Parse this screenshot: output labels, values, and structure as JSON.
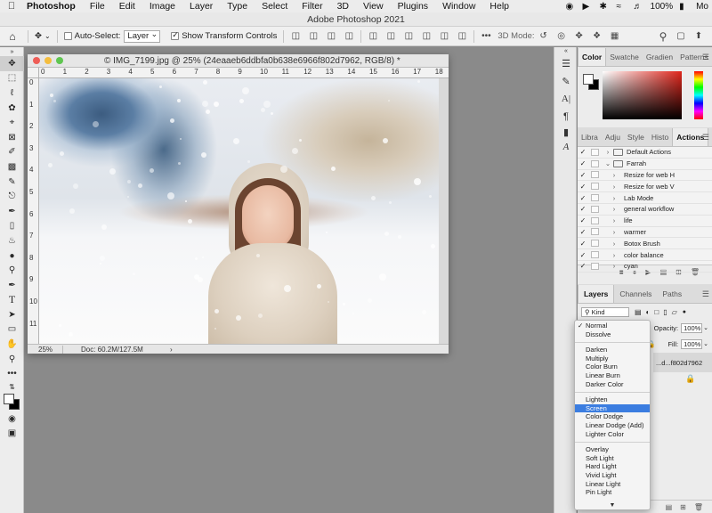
{
  "menubar": {
    "app": "Photoshop",
    "items": [
      "File",
      "Edit",
      "Image",
      "Layer",
      "Type",
      "Select",
      "Filter",
      "3D",
      "View",
      "Plugins",
      "Window",
      "Help"
    ],
    "battery": "100%",
    "user": "Mo"
  },
  "window": {
    "title": "Adobe Photoshop 2021"
  },
  "options": {
    "auto_select_label": "Auto-Select:",
    "auto_select_value": "Layer",
    "show_transform_label": "Show Transform Controls",
    "mode_3d_label": "3D Mode:"
  },
  "document": {
    "title": "© IMG_7199.jpg @ 25% (24eaaeb6ddbfa0b638e6966f802d7962, RGB/8) *",
    "ruler_h": [
      "0",
      "1",
      "2",
      "3",
      "4",
      "5",
      "6",
      "7",
      "8",
      "9",
      "10",
      "11",
      "12",
      "13",
      "14",
      "15",
      "16",
      "17",
      "18"
    ],
    "ruler_v": [
      "0",
      "1",
      "2",
      "3",
      "4",
      "5",
      "6",
      "7",
      "8",
      "9",
      "10",
      "11"
    ],
    "zoom": "25%",
    "doc_info": "Doc: 60.2M/127.5M"
  },
  "panels": {
    "color_tabs": [
      "Color",
      "Swatche",
      "Gradien",
      "Patterns"
    ],
    "actions_tabs": [
      "Libra",
      "Adju",
      "Style",
      "Histo",
      "Actions"
    ],
    "actions": [
      {
        "label": "Default Actions",
        "folder": true,
        "indent": 0
      },
      {
        "label": "Farrah",
        "folder": true,
        "indent": 0,
        "open": true
      },
      {
        "label": "Resize for web H",
        "folder": false,
        "indent": 1
      },
      {
        "label": "Resize for web V",
        "folder": false,
        "indent": 1
      },
      {
        "label": "Lab Mode",
        "folder": false,
        "indent": 1
      },
      {
        "label": "general workflow",
        "folder": false,
        "indent": 1
      },
      {
        "label": "life",
        "folder": false,
        "indent": 1
      },
      {
        "label": "warmer",
        "folder": false,
        "indent": 1
      },
      {
        "label": "Botox Brush",
        "folder": false,
        "indent": 1
      },
      {
        "label": "color balance",
        "folder": false,
        "indent": 1
      },
      {
        "label": "cyan",
        "folder": false,
        "indent": 1
      }
    ],
    "layers_tabs": [
      "Layers",
      "Channels",
      "Paths"
    ],
    "kind_label": "Kind",
    "opacity_label": "Opacity:",
    "opacity_value": "100%",
    "fill_label": "Fill:",
    "fill_value": "100%",
    "layer_name": "...d...f802d7962"
  },
  "blend_modes": {
    "groups": [
      [
        "Normal",
        "Dissolve"
      ],
      [
        "Darken",
        "Multiply",
        "Color Burn",
        "Linear Burn",
        "Darker Color"
      ],
      [
        "Lighten",
        "Screen",
        "Color Dodge",
        "Linear Dodge (Add)",
        "Lighter Color"
      ],
      [
        "Overlay",
        "Soft Light",
        "Hard Light",
        "Vivid Light",
        "Linear Light",
        "Pin Light"
      ]
    ],
    "checked": "Normal",
    "highlighted": "Screen"
  },
  "colors": {
    "accent": "#3b7de0",
    "fg": "#ffffff",
    "bg": "#000000"
  }
}
